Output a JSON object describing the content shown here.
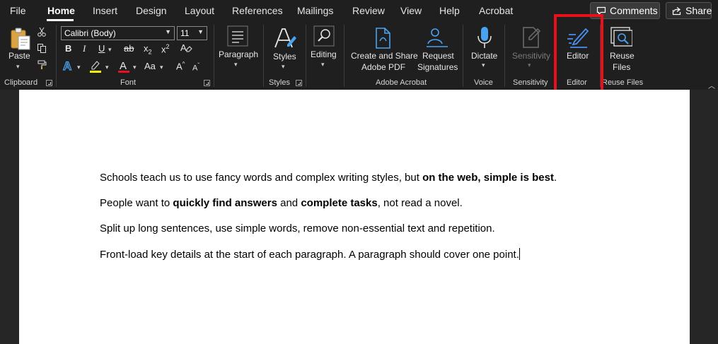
{
  "tabs": [
    {
      "label": "File",
      "active": false
    },
    {
      "label": "Home",
      "active": true
    },
    {
      "label": "Insert",
      "active": false
    },
    {
      "label": "Design",
      "active": false
    },
    {
      "label": "Layout",
      "active": false
    },
    {
      "label": "References",
      "active": false
    },
    {
      "label": "Mailings",
      "active": false
    },
    {
      "label": "Review",
      "active": false
    },
    {
      "label": "View",
      "active": false
    },
    {
      "label": "Help",
      "active": false
    },
    {
      "label": "Acrobat",
      "active": false
    }
  ],
  "top_buttons": {
    "comments": "Comments",
    "share": "Share"
  },
  "ribbon": {
    "clipboard": {
      "paste_label": "Paste",
      "group_label": "Clipboard"
    },
    "font": {
      "font_name": "Calibri (Body)",
      "font_size": "11",
      "group_label": "Font",
      "bold": "B",
      "italic": "I",
      "underline": "U",
      "strikethrough": "ab",
      "subscript": "x",
      "subscript_mark": "2",
      "superscript": "x",
      "superscript_mark": "2",
      "change_case": "Aa",
      "grow": "A",
      "shrink": "A"
    },
    "paragraph": {
      "label": "Paragraph"
    },
    "styles": {
      "label": "Styles",
      "group_label": "Styles"
    },
    "editing": {
      "label": "Editing"
    },
    "acrobat": {
      "create_line1": "Create and Share",
      "create_line2": "Adobe PDF",
      "request_line1": "Request",
      "request_line2": "Signatures",
      "group_label": "Adobe Acrobat"
    },
    "voice": {
      "label": "Dictate",
      "group_label": "Voice"
    },
    "sensitivity": {
      "label": "Sensitivity",
      "group_label": "Sensitivity"
    },
    "editor": {
      "label": "Editor",
      "group_label": "Editor"
    },
    "reuse": {
      "line1": "Reuse",
      "line2": "Files",
      "group_label": "Reuse Files"
    }
  },
  "colors": {
    "highlight_box": "#e8101b",
    "dictate_blue": "#4aa3f0",
    "acrobat_blue": "#4aa3f0",
    "editor_blue": "#4a8ff0",
    "highlighter_yellow": "#ffff00",
    "font_color_red": "#e81123"
  },
  "document": {
    "p1": {
      "a": "Schools teach us to use fancy words and complex writing styles, but ",
      "b": "on the web, simple is best",
      "c": "."
    },
    "p2": {
      "a": "People want to ",
      "b": "quickly find answers",
      "c": " and ",
      "d": "complete tasks",
      "e": ", not read a novel."
    },
    "p3": "Split up long sentences, use simple words, remove non-essential text and repetition.",
    "p4": "Front-load key details at the start of each paragraph. A paragraph should cover one point."
  }
}
